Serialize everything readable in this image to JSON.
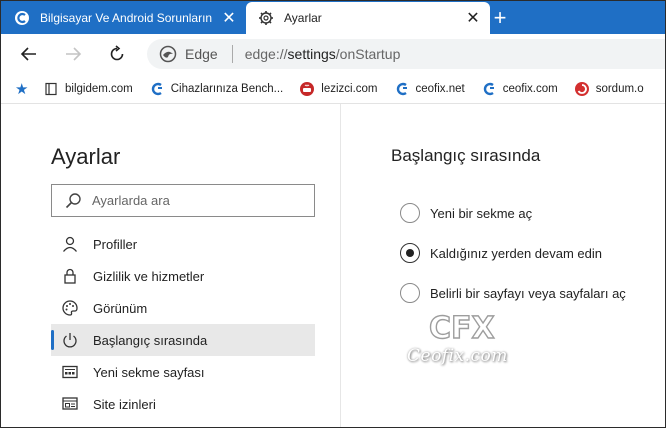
{
  "tabs": [
    {
      "title": "Bilgisayar Ve Android Sorunların",
      "icon": "ceofix-favicon",
      "active": false
    },
    {
      "title": "Ayarlar",
      "icon": "gear-icon",
      "active": true
    }
  ],
  "address": {
    "scheme_label": "Edge",
    "url_prefix": "edge://",
    "url_host": "settings",
    "url_path": "/onStartup"
  },
  "bookmarks": [
    {
      "label": "bilgidem.com",
      "icon": "book-icon"
    },
    {
      "label": "Cihazlarınıza Bench...",
      "icon": "ceofix-icon"
    },
    {
      "label": "lezizci.com",
      "icon": "pot-icon"
    },
    {
      "label": "ceofix.net",
      "icon": "ceofix-icon"
    },
    {
      "label": "ceofix.com",
      "icon": "ceofix-icon"
    },
    {
      "label": "sordum.o",
      "icon": "sordum-icon"
    }
  ],
  "sidebar": {
    "title": "Ayarlar",
    "search_placeholder": "Ayarlarda ara",
    "items": [
      {
        "label": "Profiller",
        "icon": "person-icon",
        "selected": false
      },
      {
        "label": "Gizlilik ve hizmetler",
        "icon": "lock-icon",
        "selected": false
      },
      {
        "label": "Görünüm",
        "icon": "palette-icon",
        "selected": false
      },
      {
        "label": "Başlangıç sırasında",
        "icon": "power-icon",
        "selected": true
      },
      {
        "label": "Yeni sekme sayfası",
        "icon": "newtab-page-icon",
        "selected": false
      },
      {
        "label": "Site izinleri",
        "icon": "site-permissions-icon",
        "selected": false
      }
    ]
  },
  "main": {
    "section_title": "Başlangıç sırasında",
    "options": [
      {
        "label": "Yeni bir sekme aç",
        "checked": false
      },
      {
        "label": "Kaldığınız yerden devam edin",
        "checked": true
      },
      {
        "label": "Belirli bir sayfayı veya sayfaları aç",
        "checked": false
      }
    ]
  },
  "watermark": {
    "logo": "CFX",
    "text": "Ceofix.com"
  },
  "colors": {
    "accent": "#1f6fc5",
    "tab_strip": "#1f6fc5"
  }
}
